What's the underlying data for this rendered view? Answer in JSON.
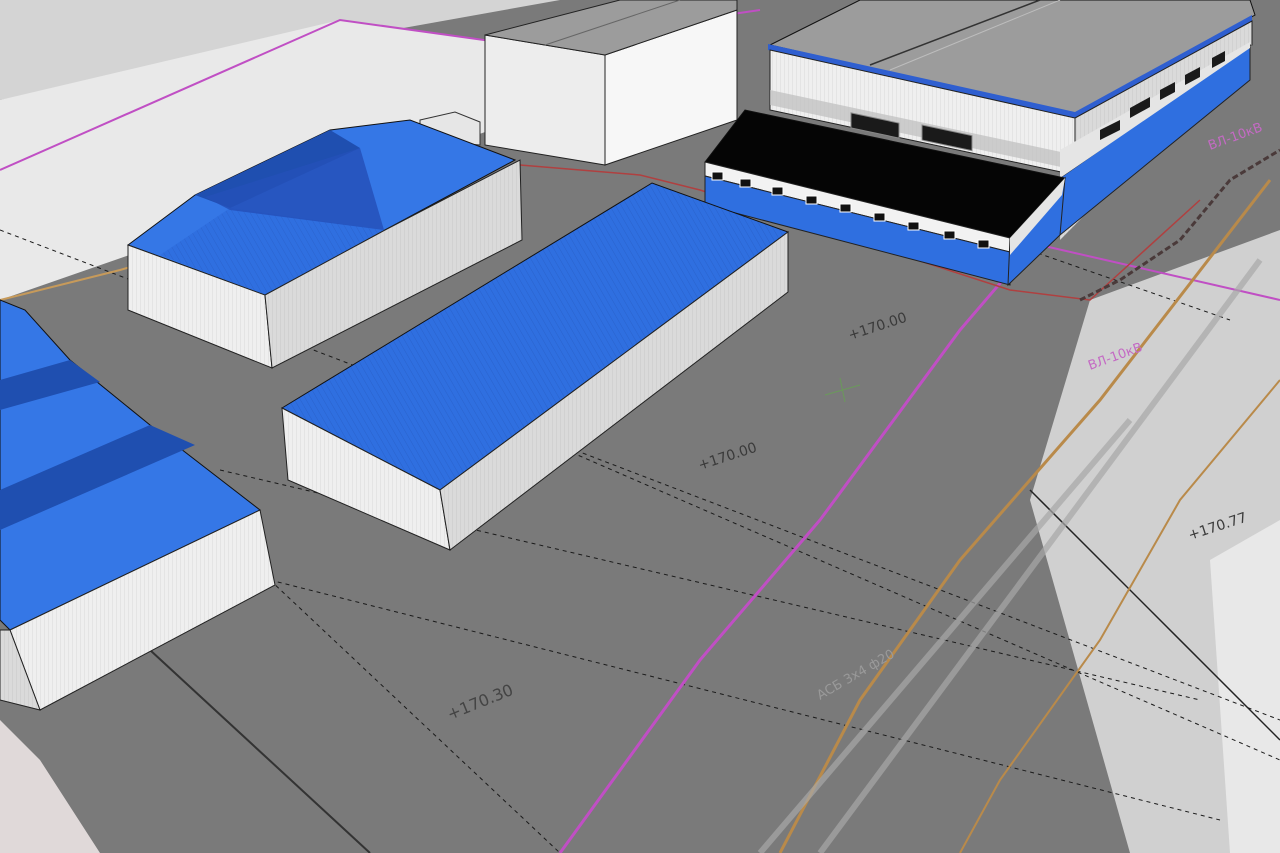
{
  "scene": {
    "elevation_labels": [
      "+170.00",
      "+170.00",
      "+170.30",
      "+170.77"
    ],
    "map_labels": [
      "ВЛ-10кВ",
      "ВЛ-10кВ",
      "АСБ 3x4 ф20"
    ],
    "colors": {
      "ground": "#7a7a7a",
      "roof_blue": "#2f6fe0",
      "roof_blue_dark": "#2050b0",
      "wall_light": "#f2f2f2",
      "wall_shade": "#d6d6d6",
      "roof_gray": "#9c9c9c",
      "flat_roof_black": "#050505",
      "pink_line": "#c04fc4",
      "orange_line": "#b98a4a"
    }
  }
}
